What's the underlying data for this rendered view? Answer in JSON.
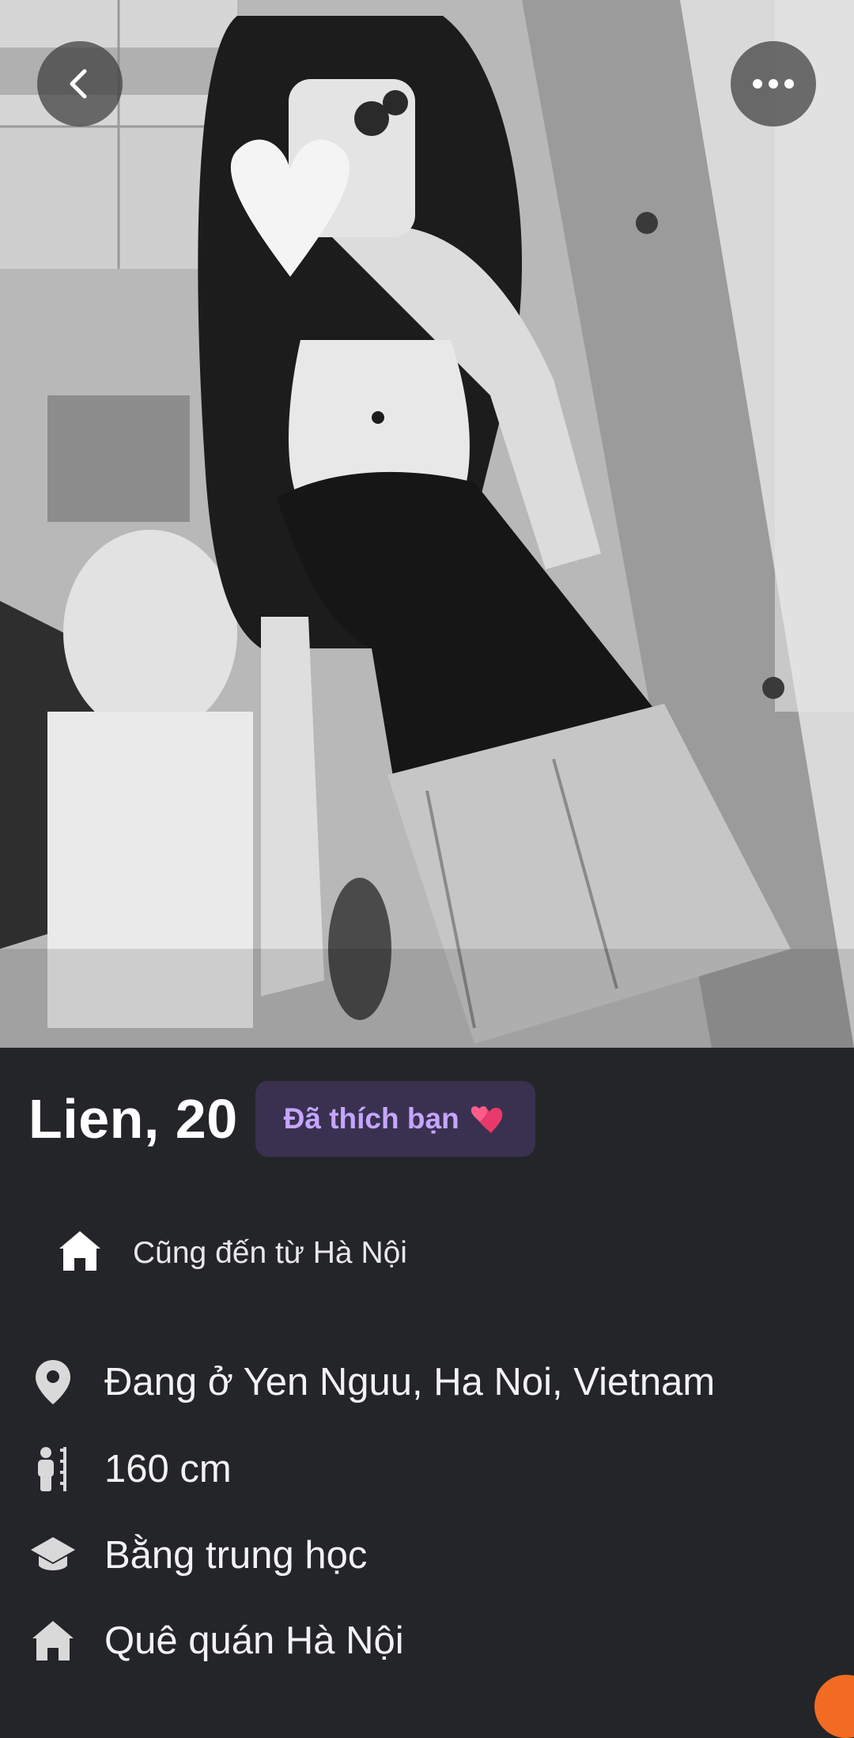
{
  "header": {
    "back_icon": "chevron-left-icon",
    "more_icon": "more-horizontal-icon"
  },
  "profile": {
    "name_age": "Lien, 20",
    "liked_badge": "Đã thích bạn",
    "liked_badge_emoji": "two-hearts-icon",
    "common": {
      "icon": "home-icon",
      "label": "Cũng đến từ Hà Nội"
    },
    "details": [
      {
        "icon": "location-pin-icon",
        "label": "Đang ở Yen Nguu, Ha Noi, Vietnam"
      },
      {
        "icon": "height-icon",
        "label": "160 cm"
      },
      {
        "icon": "education-cap-icon",
        "label": "Bằng trung học"
      },
      {
        "icon": "home-icon",
        "label": "Quê quán Hà Nội"
      }
    ]
  },
  "colors": {
    "background": "#242528",
    "badge_bg": "#3a3150",
    "badge_text": "#c4a6ff",
    "icon_color": "#d9d9d9",
    "accent_orange": "#f26b22"
  }
}
